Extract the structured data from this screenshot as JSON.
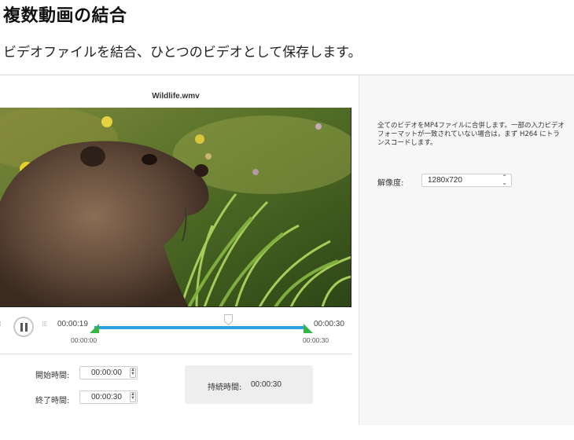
{
  "header": {
    "title": "複数動画の結合",
    "subtitle": "ビデオファイルを結合、ひとつのビデオとして保存します。"
  },
  "player": {
    "filename": "Wildlife.wmv",
    "current_time": "00:00:19",
    "end_time": "00:00:30",
    "trim_start_label": "00:00:00",
    "trim_end_label": "00:00:30",
    "playhead_fraction": 0.63
  },
  "trim": {
    "start_label": "開始時間:",
    "start_value": "00:00:00",
    "end_label": "終了時間:",
    "end_value": "00:00:30",
    "duration_label": "持続時間:",
    "duration_value": "00:00:30"
  },
  "settings": {
    "description": "全てのビデオをMP4ファイルに合併します。一部の入力ビデオフォーマットが一致されていない場合は，まず H264 にトランスコードします。",
    "resolution_label": "解像度:",
    "resolution_value": "1280x720"
  },
  "icons": {
    "play_pause": "pause-icon",
    "grip": "drag-grip-icon",
    "select_arrow": "chevron-updown-icon"
  },
  "colors": {
    "track": "#2d9fe0",
    "trim_handle": "#33b547"
  }
}
